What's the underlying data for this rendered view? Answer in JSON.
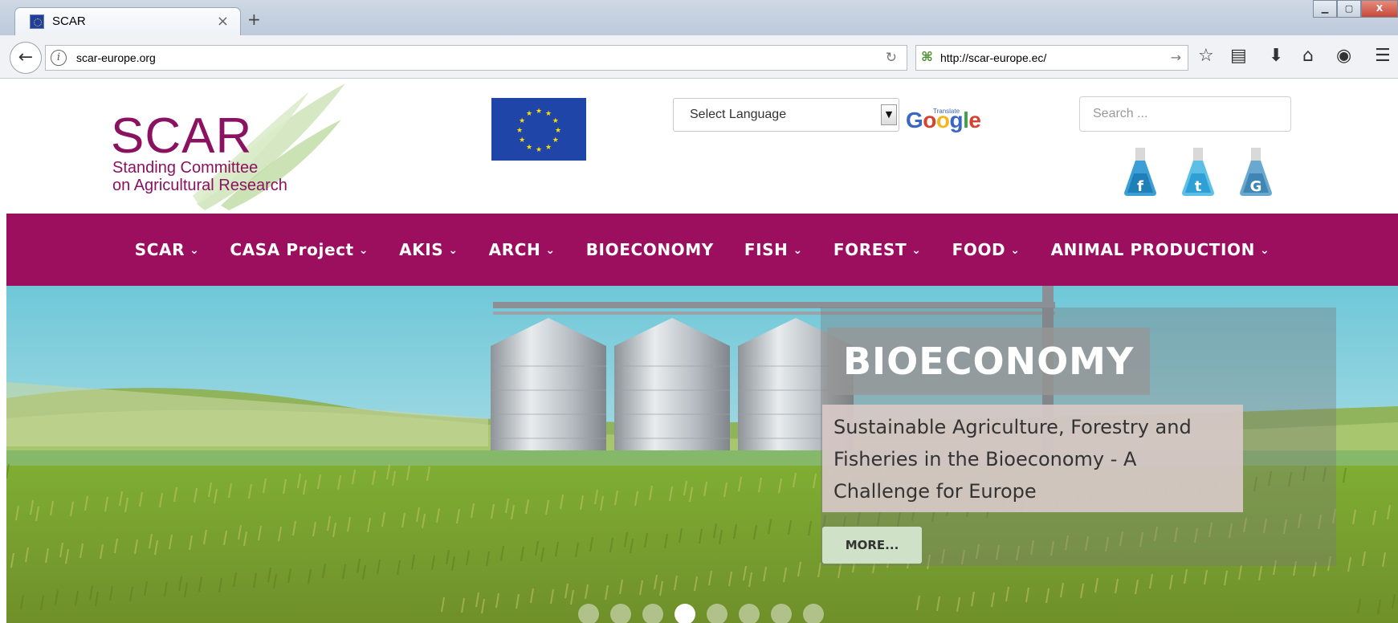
{
  "browser": {
    "tab_title": "SCAR",
    "tab_close": "×",
    "new_tab": "+",
    "url": "scar-europe.org",
    "search_box_value": "http://scar-europe.ec/",
    "window_controls": [
      "▁",
      "▢",
      "X"
    ]
  },
  "header": {
    "logo_word": "SCAR",
    "logo_line1": "Standing Committee",
    "logo_line2": "on Agricultural Research",
    "language_select": "Select Language",
    "translate_label": "Translate",
    "google_brand": "Google",
    "search_placeholder": "Search ...",
    "social_icons": [
      "facebook-icon",
      "twitter-icon",
      "google-icon"
    ]
  },
  "menu": {
    "items": [
      {
        "label": "SCAR",
        "dropdown": true
      },
      {
        "label": "CASA Project",
        "dropdown": true
      },
      {
        "label": "AKIS",
        "dropdown": true
      },
      {
        "label": "ARCH",
        "dropdown": true
      },
      {
        "label": "BIOECONOMY",
        "dropdown": false
      },
      {
        "label": "FISH",
        "dropdown": true
      },
      {
        "label": "FOREST",
        "dropdown": true
      },
      {
        "label": "FOOD",
        "dropdown": true
      },
      {
        "label": "ANIMAL PRODUCTION",
        "dropdown": true
      }
    ]
  },
  "slider": {
    "title": "BIOECONOMY",
    "description": "Sustainable Agriculture, Forestry and Fisheries in the Bioeconomy - A Challenge for Europe",
    "more_label": "MORE...",
    "dot_count": 8,
    "active_dot": 4
  },
  "colors": {
    "brand": "#9c0f5f",
    "logo": "#8a1261",
    "eu_blue": "#1f45a8",
    "eu_star": "#ffdd00",
    "more_button": "#cfe1c6"
  }
}
